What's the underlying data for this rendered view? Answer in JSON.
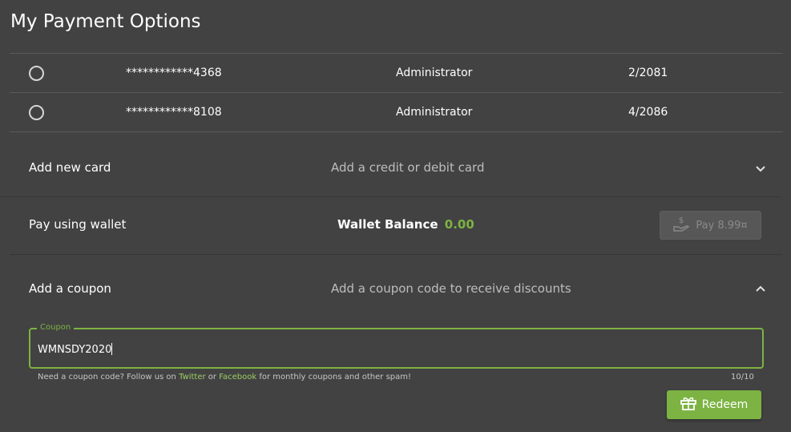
{
  "page": {
    "title": "My Payment Options"
  },
  "cards": [
    {
      "number": "************4368",
      "holder": "Administrator",
      "expiry": "2/2081"
    },
    {
      "number": "************8108",
      "holder": "Administrator",
      "expiry": "4/2086"
    }
  ],
  "add_card": {
    "label": "Add new card",
    "description": "Add a credit or debit card",
    "icon": "chevron-down-icon"
  },
  "wallet": {
    "label": "Pay using wallet",
    "balance_label": "Wallet Balance",
    "balance_value": "0.00",
    "pay_label": "Pay 8.99¤",
    "pay_icon": "hand-coin-icon"
  },
  "coupon": {
    "label": "Add a coupon",
    "description": "Add a coupon code to receive discounts",
    "icon": "chevron-up-icon",
    "field_label": "Coupon",
    "value": "WMNSDY2020",
    "hint_prefix": "Need a coupon code? Follow us on ",
    "hint_twitter": "Twitter",
    "hint_or": " or ",
    "hint_facebook": "Facebook",
    "hint_suffix": " for monthly coupons and other spam!",
    "counter": "10/10",
    "redeem_label": "Redeem",
    "redeem_icon": "gift-icon"
  },
  "colors": {
    "background": "#424242",
    "accent": "#7cb342",
    "link": "#9ccc65"
  }
}
